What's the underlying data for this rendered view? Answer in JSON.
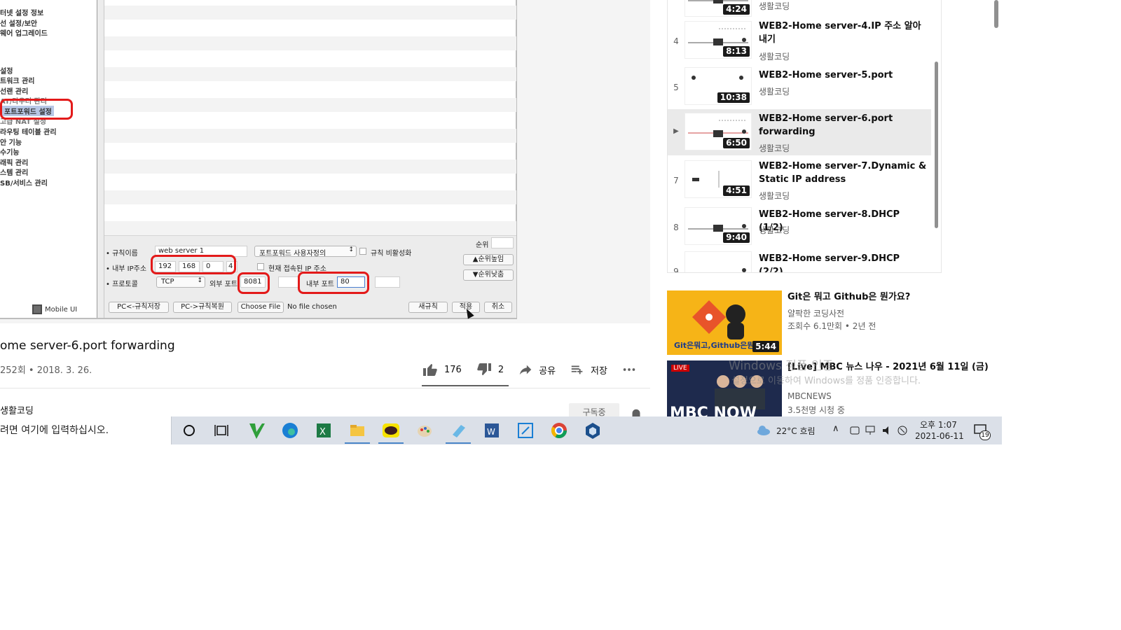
{
  "router": {
    "menu": [
      "터넷 설정 정보",
      "선 설정/보안",
      "웨어 업그레이드",
      "설정",
      "트워크 관리",
      "선랜 관리",
      "AT/라우터 관리",
      "포트포워드 설정",
      "고급 NAT 설정",
      "라우팅 테이블 관리",
      "안 기능",
      "수기능",
      "래픽 관리",
      "스템 관리",
      "SB/서비스 관리"
    ],
    "mobile_ui": "Mobile UI",
    "form": {
      "rule_name_label": "• 규칙이름",
      "rule_name_value": "web server 1",
      "rule_type": "포트포워드 사용자정의",
      "disable_label": "규칙 비활성화",
      "priority_label": "순위",
      "internal_ip_label": "• 내부 IP주소",
      "ip": [
        "192",
        "168",
        "0",
        "4"
      ],
      "current_ip_label": "현재 접속된 IP 주소",
      "priority_up": "▲순위높임",
      "priority_down": "▼순위낮춤",
      "protocol_label": "• 프로토콜",
      "protocol_value": "TCP",
      "external_port_label": "외부 포트",
      "external_port_value": "8081",
      "internal_port_label": "내부 포트",
      "internal_port_value": "80",
      "pc_save": "PC<-규칙저장",
      "pc_restore": "PC->규칙복원",
      "choose_file": "Choose File",
      "no_file": "No file chosen",
      "new_rule": "새규칙",
      "apply": "적용",
      "cancel": "취소"
    }
  },
  "video": {
    "title": "ome server-6.port forwarding",
    "meta": "252회 • 2018. 3. 26.",
    "likes": "176",
    "dislikes": "2",
    "share": "공유",
    "save": "저장",
    "channel": "생활코딩",
    "subscribe": "구독중"
  },
  "playlist": [
    {
      "index": "",
      "title": "",
      "channel": "생활코딩",
      "duration": "4:24"
    },
    {
      "index": "4",
      "title": "WEB2-Home server-4.IP 주소 알아내기",
      "channel": "생활코딩",
      "duration": "8:13"
    },
    {
      "index": "5",
      "title": "WEB2-Home server-5.port",
      "channel": "생활코딩",
      "duration": "10:38"
    },
    {
      "index": "▶",
      "title": "WEB2-Home server-6.port forwarding",
      "channel": "생활코딩",
      "duration": "6:50"
    },
    {
      "index": "7",
      "title": "WEB2-Home server-7.Dynamic & Static IP address",
      "channel": "생활코딩",
      "duration": "4:51"
    },
    {
      "index": "8",
      "title": "WEB2-Home server-8.DHCP (1/2)",
      "channel": "생활코딩",
      "duration": "9:40"
    },
    {
      "index": "9",
      "title": "WEB2-Home server-9.DHCP (2/2)",
      "channel": "생활코딩",
      "duration": ""
    }
  ],
  "recommendations": [
    {
      "title": "Git은 뭐고 Github은 뭔가요?",
      "channel": "얄팍한 코딩사전",
      "stats": "조회수 6.1만회 • 2년 전",
      "duration": "5:44",
      "thumb_text": "Git은뭐고,Github은뭔"
    },
    {
      "title": "[Live] MBC 뉴스 나우 - 2021년 6월 11일 (금)",
      "channel": "MBCNEWS",
      "stats": "3.5천명 시청 중",
      "live": "LIVE",
      "thumb_text": "MBC NOW"
    }
  ],
  "watermark": {
    "line1": "Windows 정품 인증",
    "line2": "설정으로 이동하여 Windows를 정품 인증합니다."
  },
  "taskbar": {
    "search_placeholder": "여기에 입력하십시오.",
    "search_prefix": "려면 ",
    "weather": "22°C  흐림",
    "time": "오후 1:07",
    "date": "2021-06-11",
    "notifications": "19"
  },
  "colors": {
    "accent_red": "#e31a1a",
    "youtube_red": "#cc0000",
    "taskbar": "#dbe0e8"
  }
}
